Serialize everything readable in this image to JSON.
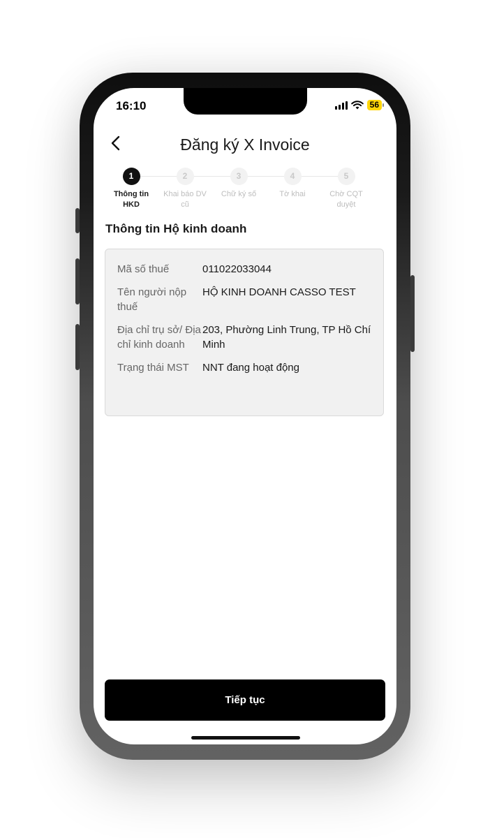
{
  "status_bar": {
    "time": "16:10",
    "battery": "56",
    "battery_color": "#ffd60a"
  },
  "header": {
    "back_icon": "chevron-left-icon",
    "title": "Đăng ký X Invoice"
  },
  "stepper": {
    "steps": [
      {
        "number": "1",
        "label_line1": "Thông tin",
        "label_line2": "HKD",
        "active": true
      },
      {
        "number": "2",
        "label_line1": "Khai báo DV",
        "label_line2": "cũ",
        "active": false
      },
      {
        "number": "3",
        "label_line1": "Chữ ký số",
        "label_line2": "",
        "active": false
      },
      {
        "number": "4",
        "label_line1": "Tờ khai",
        "label_line2": "",
        "active": false
      },
      {
        "number": "5",
        "label_line1": "Chờ CQT",
        "label_line2": "duyệt",
        "active": false
      }
    ]
  },
  "section": {
    "title": "Thông tin Hộ kinh doanh"
  },
  "info": {
    "rows": [
      {
        "label": "Mã số thuế",
        "value": "011022033044"
      },
      {
        "label": "Tên người nộp thuế",
        "value": "HỘ KINH DOANH CASSO TEST"
      },
      {
        "label": "Địa chỉ trụ sở/ Địa chỉ kinh doanh",
        "value": "203, Phường Linh Trung, TP Hồ Chí Minh"
      },
      {
        "label": "Trạng thái MST",
        "value": "NNT đang hoạt động"
      }
    ]
  },
  "footer": {
    "continue_label": "Tiếp tục"
  }
}
